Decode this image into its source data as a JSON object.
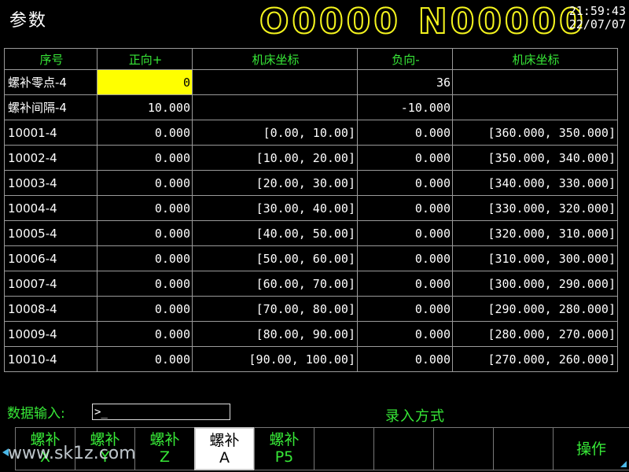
{
  "header": {
    "title": "参数",
    "program_o": "O0000",
    "program_n": "N00000",
    "time": "21:59:43",
    "date": "22/07/07"
  },
  "table": {
    "columns": [
      "序号",
      "正向+",
      "机床坐标",
      "负向-",
      "机床坐标"
    ],
    "rows": [
      {
        "name": "螺补零点-4",
        "pos": "0",
        "pos_coord": "",
        "neg": "36",
        "neg_coord": ""
      },
      {
        "name": "螺补间隔-4",
        "pos": "10.000",
        "pos_coord": "",
        "neg": "-10.000",
        "neg_coord": ""
      },
      {
        "name": "10001-4",
        "pos": "0.000",
        "pos_coord": "[0.00, 10.00]",
        "neg": "0.000",
        "neg_coord": "[360.000, 350.000]"
      },
      {
        "name": "10002-4",
        "pos": "0.000",
        "pos_coord": "[10.00, 20.00]",
        "neg": "0.000",
        "neg_coord": "[350.000, 340.000]"
      },
      {
        "name": "10003-4",
        "pos": "0.000",
        "pos_coord": "[20.00, 30.00]",
        "neg": "0.000",
        "neg_coord": "[340.000, 330.000]"
      },
      {
        "name": "10004-4",
        "pos": "0.000",
        "pos_coord": "[30.00, 40.00]",
        "neg": "0.000",
        "neg_coord": "[330.000, 320.000]"
      },
      {
        "name": "10005-4",
        "pos": "0.000",
        "pos_coord": "[40.00, 50.00]",
        "neg": "0.000",
        "neg_coord": "[320.000, 310.000]"
      },
      {
        "name": "10006-4",
        "pos": "0.000",
        "pos_coord": "[50.00, 60.00]",
        "neg": "0.000",
        "neg_coord": "[310.000, 300.000]"
      },
      {
        "name": "10007-4",
        "pos": "0.000",
        "pos_coord": "[60.00, 70.00]",
        "neg": "0.000",
        "neg_coord": "[300.000, 290.000]"
      },
      {
        "name": "10008-4",
        "pos": "0.000",
        "pos_coord": "[70.00, 80.00]",
        "neg": "0.000",
        "neg_coord": "[290.000, 280.000]"
      },
      {
        "name": "10009-4",
        "pos": "0.000",
        "pos_coord": "[80.00, 90.00]",
        "neg": "0.000",
        "neg_coord": "[280.000, 270.000]"
      },
      {
        "name": "10010-4",
        "pos": "0.000",
        "pos_coord": "[90.00, 100.00]",
        "neg": "0.000",
        "neg_coord": "[270.000, 260.000]"
      }
    ]
  },
  "input": {
    "label": "数据输入:",
    "value": ">_"
  },
  "mode": "录入方式",
  "softkeys": [
    {
      "line1": "螺补",
      "line2": "X",
      "active": false
    },
    {
      "line1": "螺补",
      "line2": "Y",
      "active": false
    },
    {
      "line1": "螺补",
      "line2": "Z",
      "active": false
    },
    {
      "line1": "螺补",
      "line2": "A",
      "active": true
    },
    {
      "line1": "螺补",
      "line2": "P5",
      "active": false
    },
    {
      "line1": "",
      "line2": "",
      "active": false
    },
    {
      "line1": "",
      "line2": "",
      "active": false
    },
    {
      "line1": "",
      "line2": "",
      "active": false
    },
    {
      "line1": "",
      "line2": "",
      "active": false
    },
    {
      "line1": "操作",
      "line2": "",
      "active": false
    },
    {
      "line1": "",
      "line2": "",
      "active": false
    }
  ],
  "watermark": "www.sk1z.com",
  "colors": {
    "accent": "#37e837",
    "highlight": "#ffff00",
    "program": "#f5f51e",
    "arrow": "#4bb8e8"
  },
  "icons": [
    "left-arrow-icon",
    "corner-arrow-icon"
  ]
}
